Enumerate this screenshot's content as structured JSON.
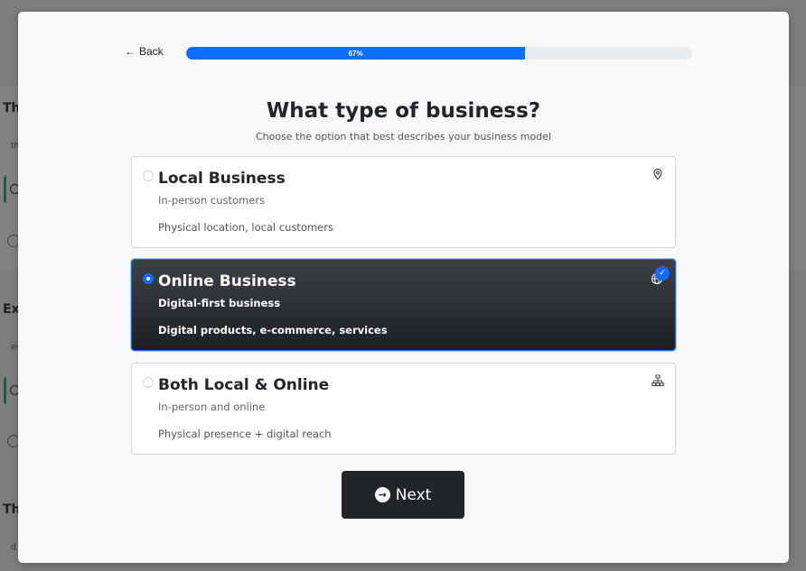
{
  "background": {
    "headings": [
      "Th",
      "Ex",
      "Th"
    ],
    "snippets": [
      "th",
      "ex",
      "d"
    ]
  },
  "header": {
    "back_label": "Back",
    "progress_label": "67%",
    "progress_value": 0.67
  },
  "main": {
    "title": "What type of business?",
    "subtitle": "Choose the option that best describes your business model"
  },
  "options": [
    {
      "title": "Local Business",
      "subtitle": "In-person customers",
      "description": "Physical location, local customers",
      "icon": "map-pin-icon",
      "selected": false
    },
    {
      "title": "Online Business",
      "subtitle": "Digital-first business",
      "description": "Digital products, e-commerce, services",
      "icon": "globe-icon",
      "selected": true
    },
    {
      "title": "Both Local & Online",
      "subtitle": "In-person and online",
      "description": "Physical presence + digital reach",
      "icon": "network-icon",
      "selected": false
    }
  ],
  "footer": {
    "next_label": "Next"
  },
  "colors": {
    "accent": "#0d6efd",
    "dark": "#212529"
  }
}
